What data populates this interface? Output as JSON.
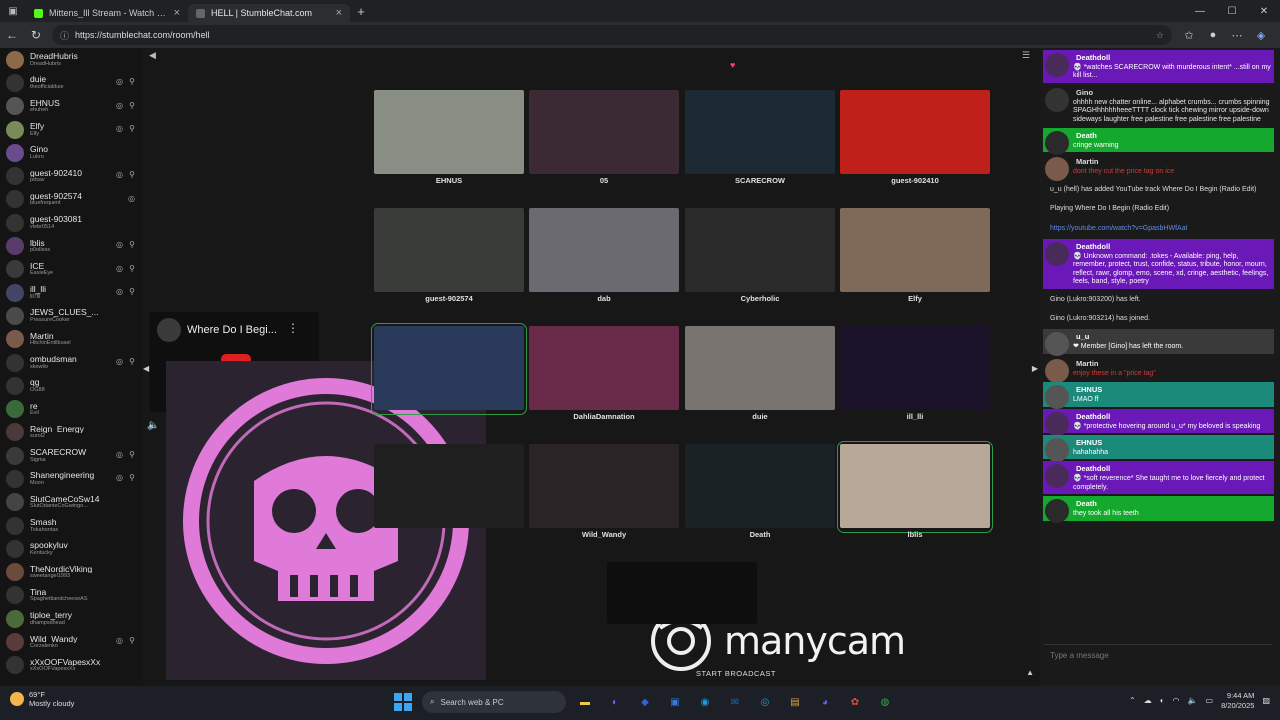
{
  "browser": {
    "tabs": [
      {
        "title": "Mittens_Ill Stream - Watch Live on Kick",
        "close": "×",
        "favicon_color": "#53fc18"
      },
      {
        "title": "HELL | StumbleChat.com",
        "close": "×",
        "favicon_color": "#666666"
      }
    ],
    "new_tab": "+",
    "window_controls": [
      "—",
      "☐",
      "✕"
    ],
    "url": "https://stumblechat.com/room/hell"
  },
  "users": [
    {
      "name": "DreadHubris",
      "handle": "DreadHubris",
      "color": "#8b6a4a",
      "icons": ""
    },
    {
      "name": "duie",
      "handle": "theofficialduie",
      "color": "#333333",
      "icons": "◎ ⚲"
    },
    {
      "name": "EHNUS",
      "handle": "ehuheh",
      "color": "#555555",
      "icons": "◎ ⚲"
    },
    {
      "name": "Elfy",
      "handle": "Elfy",
      "color": "#7a8b5a",
      "icons": "◎ ⚲"
    },
    {
      "name": "Gino",
      "handle": "Lukro",
      "color": "#6a4c8c",
      "icons": ""
    },
    {
      "name": "guest-902410",
      "handle": "pdsav",
      "color": "#333333",
      "icons": "◎ ⚲"
    },
    {
      "name": "guest-902574",
      "handle": "bluefrequent",
      "color": "#333333",
      "icons": "◎"
    },
    {
      "name": "guest-903081",
      "handle": "vlebr0514",
      "color": "#333333",
      "icons": ""
    },
    {
      "name": "lblis",
      "handle": "p0olless",
      "color": "#5a3c6c",
      "icons": "◎ ⚲"
    },
    {
      "name": "ICE",
      "handle": "EasieEye",
      "color": "#3a3a3a",
      "icons": "◎ ⚲"
    },
    {
      "name": "ill_lli",
      "handle": "lll7lll",
      "color": "#444466",
      "icons": "◎ ⚲"
    },
    {
      "name": "JEWS_CLUES_...",
      "handle": "PressureCooker",
      "color": "#4a4a4a",
      "icons": ""
    },
    {
      "name": "Martin",
      "handle": "HitchinEntilbusel",
      "color": "#7a5a4a",
      "icons": ""
    },
    {
      "name": "ombudsman",
      "handle": "skewlio",
      "color": "#333333",
      "icons": "◎ ⚲"
    },
    {
      "name": "qg",
      "handle": "OG88",
      "color": "#333333",
      "icons": ""
    },
    {
      "name": "re",
      "handle": "Evil",
      "color": "#3a6a3a",
      "icons": ""
    },
    {
      "name": "Reign_Energy",
      "handle": "surol2",
      "color": "#4a3a3a",
      "icons": ""
    },
    {
      "name": "SCARECROW",
      "handle": "Sigma",
      "color": "#3a3a3a",
      "icons": "◎ ⚲"
    },
    {
      "name": "Shanengineering",
      "handle": "Moon",
      "color": "#333333",
      "icons": "◎ ⚲"
    },
    {
      "name": "SlutCameCoSw14",
      "handle": "SlutOdanteCoGwingo...",
      "color": "#444444",
      "icons": ""
    },
    {
      "name": "Smash",
      "handle": "Tokahontas",
      "color": "#333333",
      "icons": ""
    },
    {
      "name": "spookyluv",
      "handle": "Kentucky",
      "color": "#333333",
      "icons": ""
    },
    {
      "name": "TheNordicViking",
      "handle": "sweetangel1993",
      "color": "#6a4a3a",
      "icons": ""
    },
    {
      "name": "Tina",
      "handle": "SpaghettiandcheeseAS",
      "color": "#333333",
      "icons": ""
    },
    {
      "name": "tiploe_terry",
      "handle": "dhampsdhead",
      "color": "#4a6a3a",
      "icons": ""
    },
    {
      "name": "Wild_Wandy",
      "handle": "Corzalenko",
      "color": "#5a3a3a",
      "icons": "◎ ⚲"
    },
    {
      "name": "xXxOOFVapesxXx",
      "handle": "xXxOOFVapesxXx",
      "color": "#333333",
      "icons": ""
    }
  ],
  "cams": [
    {
      "label": "EHNUS",
      "color": "#8a8f86",
      "hl": false
    },
    {
      "label": "05",
      "color": "#3b2a33",
      "hl": false
    },
    {
      "label": "SCARECROW",
      "color": "#1e2a33",
      "hl": false
    },
    {
      "label": "guest-902410",
      "color": "#c0201a",
      "hl": false
    },
    {
      "label": "guest-902574",
      "color": "#3a3c3a",
      "hl": false
    },
    {
      "label": "dab",
      "color": "#6b6a70",
      "hl": false
    },
    {
      "label": "Cyberholic",
      "color": "#2a2a2a",
      "hl": false
    },
    {
      "label": "Elfy",
      "color": "#7f6a5a",
      "hl": false
    },
    {
      "label": "",
      "color": "#2a3a5a",
      "hl": true
    },
    {
      "label": "DahliaDamnation",
      "color": "#6a2a4a",
      "hl": false
    },
    {
      "label": "duie",
      "color": "#7a7470",
      "hl": false
    },
    {
      "label": "ill_lli",
      "color": "#1a1228",
      "hl": false
    },
    {
      "label": "",
      "color": "#1f1f1f",
      "hl": false
    },
    {
      "label": "Wild_Wandy",
      "color": "#2a2426",
      "hl": false
    },
    {
      "label": "Death",
      "color": "#1a2226",
      "hl": false
    },
    {
      "label": "lblis",
      "color": "#b8a898",
      "hl": true
    }
  ],
  "youtube": {
    "title": "Where Do I Begi...",
    "menu": "⋮"
  },
  "manycam": {
    "logo": "manycam",
    "start": "START BROADCAST"
  },
  "chat": {
    "messages": [
      {
        "type": "purple",
        "name": "Deathdoll",
        "text": "💀 *watches SCARECROW with murderous intent* ...still on my kill list...",
        "color": "#4a2a5a"
      },
      {
        "type": "plain",
        "name": "Gino",
        "text": "ohhhh new chatter online... alphabet crumbs... crumbs spinning SPAGHhhhhhheeeTTTT clock tick chewing mirror upside-down sideways laughter free palestine free palestine free palestine",
        "color": "#333333"
      },
      {
        "type": "green",
        "name": "Death",
        "text": "cringe warning",
        "color": "#2a2a2a"
      },
      {
        "type": "plain",
        "name": "Martin",
        "text": "dont they cut the price tag on ice",
        "color": "#7a5a4a",
        "textcolor": "#d23a3a"
      },
      {
        "type": "sys",
        "text": "u_u (hell) has added YouTube track Where Do I Begin (Radio Edit)"
      },
      {
        "type": "sys",
        "text": "Playing Where Do I Begin (Radio Edit)"
      },
      {
        "type": "link",
        "text": "https://youtube.com/watch?v=GpasbHWfAaI"
      },
      {
        "type": "purple",
        "name": "Deathdoll",
        "text": "💀 Unknown command: .tokes - Available: ping, help, remember, protect, trust, confide, status, tribute, honor, mourn, reflect, rawr, glomp, emo, scene, xd, cringe, aesthetic, feelings, feels, band, style, poetry",
        "color": "#4a2a5a"
      },
      {
        "type": "sys",
        "text": "Gino (Lukro:903200) has left."
      },
      {
        "type": "sys",
        "text": "Gino (Lukro:903214) has joined."
      },
      {
        "type": "grey",
        "name": "u_u",
        "text": "❤ Member [Gino] has left the room.",
        "color": "#555555"
      },
      {
        "type": "plain",
        "name": "Martin",
        "text": "enjoy these in a \"price tag\"",
        "color": "#7a5a4a",
        "textcolor": "#d23a3a"
      },
      {
        "type": "teal",
        "name": "EHNUS",
        "text": "LMAO ff",
        "color": "#555555"
      },
      {
        "type": "purple",
        "name": "Deathdoll",
        "text": "💀 *protective hovering around u_u* my beloved is speaking",
        "color": "#4a2a5a"
      },
      {
        "type": "teal",
        "name": "EHNUS",
        "text": "hahahahha",
        "color": "#555555"
      },
      {
        "type": "purple",
        "name": "Deathdoll",
        "text": "💀 *soft reverence* She taught me to love fiercely and protect completely.",
        "color": "#4a2a5a"
      },
      {
        "type": "green",
        "name": "Death",
        "text": "they took all his teeth",
        "color": "#2a2a2a"
      }
    ],
    "input_placeholder": "Type a message"
  },
  "taskbar": {
    "temp": "69°F",
    "weather": "Mostly cloudy",
    "search_placeholder": "Search web & PC",
    "time": "9:44 AM",
    "date": "8/20/2025",
    "apps": [
      {
        "glyph": "▬",
        "color": "#f2c94c"
      },
      {
        "glyph": "◐",
        "color": "#7b5cff"
      },
      {
        "glyph": "◆",
        "color": "#2d64d8"
      },
      {
        "glyph": "▣",
        "color": "#3a7bd5"
      },
      {
        "glyph": "◉",
        "color": "#1b9de2"
      },
      {
        "glyph": "✉",
        "color": "#0f6cbd"
      },
      {
        "glyph": "◎",
        "color": "#1fa1d6"
      },
      {
        "glyph": "▤",
        "color": "#d9a441"
      },
      {
        "glyph": "◕",
        "color": "#5865f2"
      },
      {
        "glyph": "✿",
        "color": "#e24a4a"
      },
      {
        "glyph": "◍",
        "color": "#34a853"
      }
    ]
  }
}
